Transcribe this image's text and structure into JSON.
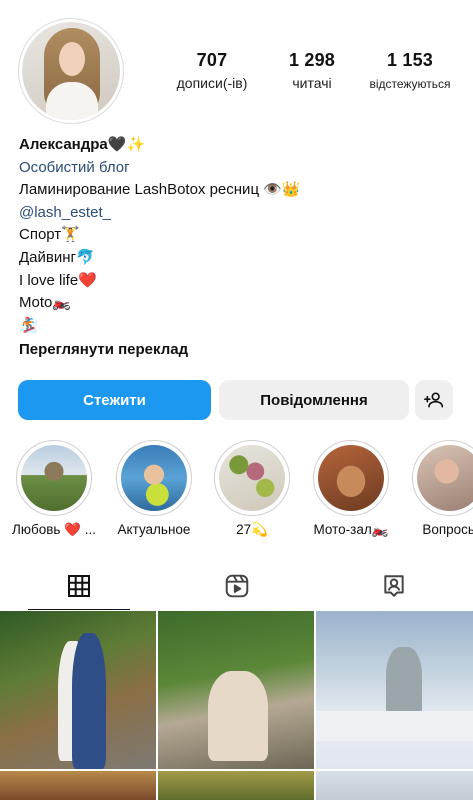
{
  "profile": {
    "stats": [
      {
        "value": "707",
        "label": "дописи(-ів)"
      },
      {
        "value": "1 298",
        "label": "читачі"
      },
      {
        "value": "1 153",
        "label": "відстежуються"
      }
    ],
    "bio": {
      "name": "Александра🖤✨",
      "category": "Особистий блог",
      "lines": [
        "Ламинирование LashBotox ресниц 👁️👑",
        "@lash_estet_",
        "Спорт🏋️",
        "Дайвинг🐬",
        "I love life❤️",
        "Moto🏍️",
        "🏂"
      ],
      "translate": "Переглянути переклад"
    }
  },
  "actions": {
    "follow": "Стежити",
    "message": "Повідомлення"
  },
  "highlights": [
    {
      "label": "Любовь ❤️ ...",
      "icon": "highlight-cover"
    },
    {
      "label": "Актуальное",
      "icon": "highlight-cover"
    },
    {
      "label": "27💫",
      "icon": "highlight-cover"
    },
    {
      "label": "Мото-зал🏍️",
      "icon": "highlight-cover"
    },
    {
      "label": "Вопросы",
      "icon": "highlight-cover"
    }
  ],
  "tabs": [
    {
      "icon": "grid-icon",
      "active": true
    },
    {
      "icon": "reels-icon",
      "active": false
    },
    {
      "icon": "tagged-icon",
      "active": false
    }
  ],
  "colors": {
    "accent": "#1c98f0",
    "link": "#2b4e7a"
  }
}
